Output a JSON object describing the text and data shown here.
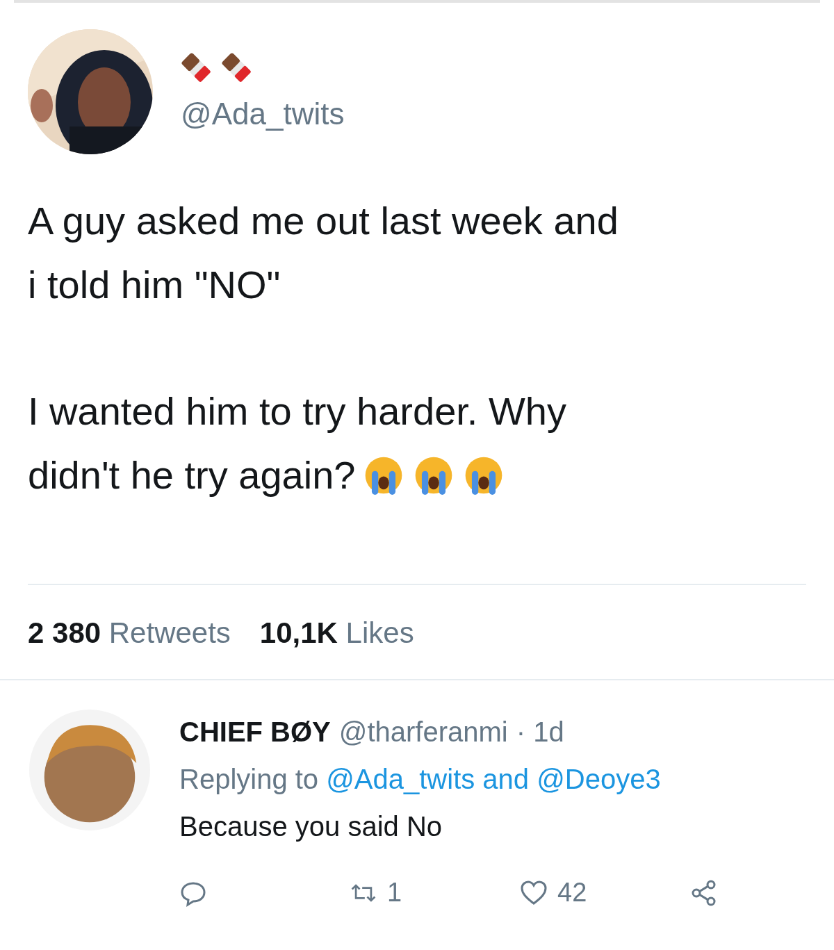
{
  "tweet": {
    "handle": "@Ada_twits",
    "paragraphs": [
      [
        "A guy asked me out last week and",
        "i told him \"NO\""
      ],
      [
        "I wanted him to try harder. Why",
        "didn't he try again?"
      ]
    ],
    "stats": [
      {
        "count": "2 380",
        "label": "Retweets"
      },
      {
        "count": "10,1K",
        "label": "Likes"
      }
    ]
  },
  "reply": {
    "name": "CHIEF BØY",
    "handle": "@tharferanmi",
    "time": "· 1d",
    "replying_prefix": "Replying to",
    "replying_mentions": "@Ada_twits and @Deoye3",
    "text": "Because you said No",
    "actions": [
      {
        "kind": "reply"
      },
      {
        "kind": "retweet",
        "count": "1"
      },
      {
        "kind": "like",
        "count": "42"
      },
      {
        "kind": "share"
      }
    ]
  }
}
